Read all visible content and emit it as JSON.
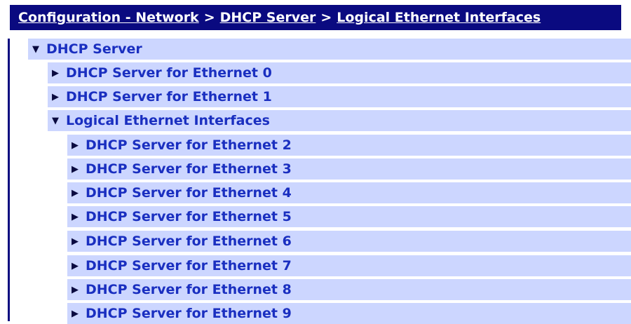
{
  "breadcrumb": {
    "items": [
      "Configuration - Network",
      "DHCP Server",
      "Logical Ethernet Interfaces"
    ],
    "separator": ">"
  },
  "tree": {
    "root": {
      "label": "DHCP Server",
      "toggle": "▼",
      "state": "expanded"
    },
    "children": [
      {
        "label": "DHCP Server for Ethernet 0",
        "toggle": "▶",
        "state": "collapsed"
      },
      {
        "label": "DHCP Server for Ethernet 1",
        "toggle": "▶",
        "state": "collapsed"
      },
      {
        "label": "Logical Ethernet Interfaces",
        "toggle": "▼",
        "state": "expanded"
      }
    ],
    "logical": [
      {
        "label": "DHCP Server for Ethernet 2",
        "toggle": "▶"
      },
      {
        "label": "DHCP Server for Ethernet 3",
        "toggle": "▶"
      },
      {
        "label": "DHCP Server for Ethernet 4",
        "toggle": "▶"
      },
      {
        "label": "DHCP Server for Ethernet 5",
        "toggle": "▶"
      },
      {
        "label": "DHCP Server for Ethernet 6",
        "toggle": "▶"
      },
      {
        "label": "DHCP Server for Ethernet 7",
        "toggle": "▶"
      },
      {
        "label": "DHCP Server for Ethernet 8",
        "toggle": "▶"
      },
      {
        "label": "DHCP Server for Ethernet 9",
        "toggle": "▶"
      }
    ]
  },
  "colors": {
    "header_bg": "#0a0a80",
    "row_bg": "#ccd6ff",
    "link_text": "#1a2fc0"
  }
}
